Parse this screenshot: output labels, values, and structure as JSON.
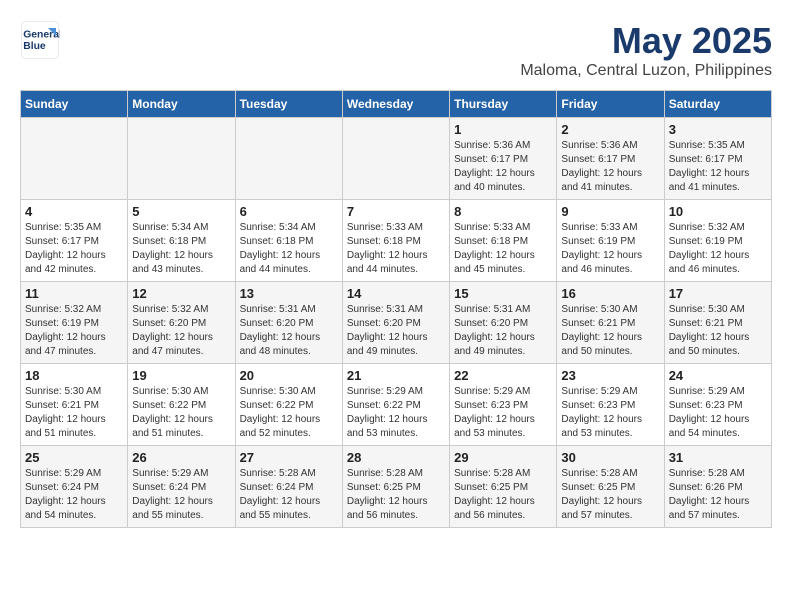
{
  "header": {
    "logo_line1": "General",
    "logo_line2": "Blue",
    "month": "May 2025",
    "location": "Maloma, Central Luzon, Philippines"
  },
  "days_of_week": [
    "Sunday",
    "Monday",
    "Tuesday",
    "Wednesday",
    "Thursday",
    "Friday",
    "Saturday"
  ],
  "weeks": [
    [
      {
        "day": "",
        "info": ""
      },
      {
        "day": "",
        "info": ""
      },
      {
        "day": "",
        "info": ""
      },
      {
        "day": "",
        "info": ""
      },
      {
        "day": "1",
        "info": "Sunrise: 5:36 AM\nSunset: 6:17 PM\nDaylight: 12 hours\nand 40 minutes."
      },
      {
        "day": "2",
        "info": "Sunrise: 5:36 AM\nSunset: 6:17 PM\nDaylight: 12 hours\nand 41 minutes."
      },
      {
        "day": "3",
        "info": "Sunrise: 5:35 AM\nSunset: 6:17 PM\nDaylight: 12 hours\nand 41 minutes."
      }
    ],
    [
      {
        "day": "4",
        "info": "Sunrise: 5:35 AM\nSunset: 6:17 PM\nDaylight: 12 hours\nand 42 minutes."
      },
      {
        "day": "5",
        "info": "Sunrise: 5:34 AM\nSunset: 6:18 PM\nDaylight: 12 hours\nand 43 minutes."
      },
      {
        "day": "6",
        "info": "Sunrise: 5:34 AM\nSunset: 6:18 PM\nDaylight: 12 hours\nand 44 minutes."
      },
      {
        "day": "7",
        "info": "Sunrise: 5:33 AM\nSunset: 6:18 PM\nDaylight: 12 hours\nand 44 minutes."
      },
      {
        "day": "8",
        "info": "Sunrise: 5:33 AM\nSunset: 6:18 PM\nDaylight: 12 hours\nand 45 minutes."
      },
      {
        "day": "9",
        "info": "Sunrise: 5:33 AM\nSunset: 6:19 PM\nDaylight: 12 hours\nand 46 minutes."
      },
      {
        "day": "10",
        "info": "Sunrise: 5:32 AM\nSunset: 6:19 PM\nDaylight: 12 hours\nand 46 minutes."
      }
    ],
    [
      {
        "day": "11",
        "info": "Sunrise: 5:32 AM\nSunset: 6:19 PM\nDaylight: 12 hours\nand 47 minutes."
      },
      {
        "day": "12",
        "info": "Sunrise: 5:32 AM\nSunset: 6:20 PM\nDaylight: 12 hours\nand 47 minutes."
      },
      {
        "day": "13",
        "info": "Sunrise: 5:31 AM\nSunset: 6:20 PM\nDaylight: 12 hours\nand 48 minutes."
      },
      {
        "day": "14",
        "info": "Sunrise: 5:31 AM\nSunset: 6:20 PM\nDaylight: 12 hours\nand 49 minutes."
      },
      {
        "day": "15",
        "info": "Sunrise: 5:31 AM\nSunset: 6:20 PM\nDaylight: 12 hours\nand 49 minutes."
      },
      {
        "day": "16",
        "info": "Sunrise: 5:30 AM\nSunset: 6:21 PM\nDaylight: 12 hours\nand 50 minutes."
      },
      {
        "day": "17",
        "info": "Sunrise: 5:30 AM\nSunset: 6:21 PM\nDaylight: 12 hours\nand 50 minutes."
      }
    ],
    [
      {
        "day": "18",
        "info": "Sunrise: 5:30 AM\nSunset: 6:21 PM\nDaylight: 12 hours\nand 51 minutes."
      },
      {
        "day": "19",
        "info": "Sunrise: 5:30 AM\nSunset: 6:22 PM\nDaylight: 12 hours\nand 51 minutes."
      },
      {
        "day": "20",
        "info": "Sunrise: 5:30 AM\nSunset: 6:22 PM\nDaylight: 12 hours\nand 52 minutes."
      },
      {
        "day": "21",
        "info": "Sunrise: 5:29 AM\nSunset: 6:22 PM\nDaylight: 12 hours\nand 53 minutes."
      },
      {
        "day": "22",
        "info": "Sunrise: 5:29 AM\nSunset: 6:23 PM\nDaylight: 12 hours\nand 53 minutes."
      },
      {
        "day": "23",
        "info": "Sunrise: 5:29 AM\nSunset: 6:23 PM\nDaylight: 12 hours\nand 53 minutes."
      },
      {
        "day": "24",
        "info": "Sunrise: 5:29 AM\nSunset: 6:23 PM\nDaylight: 12 hours\nand 54 minutes."
      }
    ],
    [
      {
        "day": "25",
        "info": "Sunrise: 5:29 AM\nSunset: 6:24 PM\nDaylight: 12 hours\nand 54 minutes."
      },
      {
        "day": "26",
        "info": "Sunrise: 5:29 AM\nSunset: 6:24 PM\nDaylight: 12 hours\nand 55 minutes."
      },
      {
        "day": "27",
        "info": "Sunrise: 5:28 AM\nSunset: 6:24 PM\nDaylight: 12 hours\nand 55 minutes."
      },
      {
        "day": "28",
        "info": "Sunrise: 5:28 AM\nSunset: 6:25 PM\nDaylight: 12 hours\nand 56 minutes."
      },
      {
        "day": "29",
        "info": "Sunrise: 5:28 AM\nSunset: 6:25 PM\nDaylight: 12 hours\nand 56 minutes."
      },
      {
        "day": "30",
        "info": "Sunrise: 5:28 AM\nSunset: 6:25 PM\nDaylight: 12 hours\nand 57 minutes."
      },
      {
        "day": "31",
        "info": "Sunrise: 5:28 AM\nSunset: 6:26 PM\nDaylight: 12 hours\nand 57 minutes."
      }
    ]
  ]
}
